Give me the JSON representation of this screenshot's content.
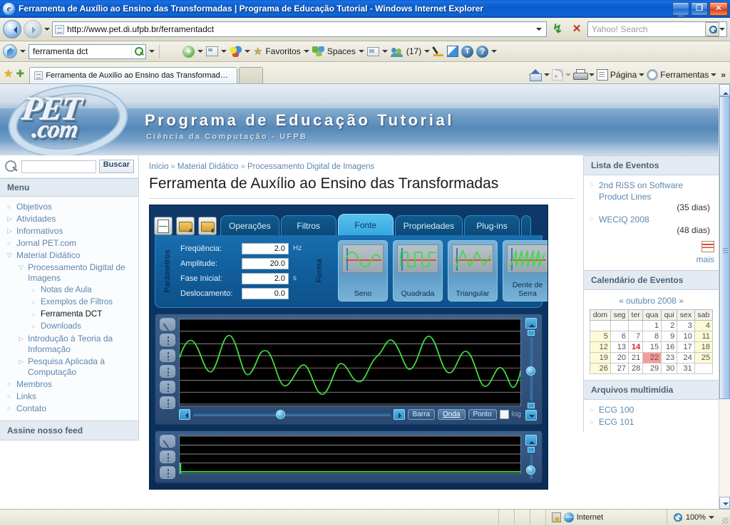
{
  "window": {
    "title": "Ferramenta de Auxílio ao Ensino das Transformadas | Programa de Educação Tutorial - Windows Internet Explorer",
    "minimize": "_",
    "maximize": "❐",
    "close": "✕"
  },
  "nav": {
    "url": "http://www.pet.di.ufpb.br/ferramentadct",
    "search_placeholder": "Yahoo! Search",
    "search_value": ""
  },
  "toolbar2": {
    "search_value": "ferramenta dct",
    "favoritos": "Favoritos",
    "spaces": "Spaces",
    "people_count": "(17)"
  },
  "tabbar": {
    "tab_title": "Ferramenta de Auxilio ao Ensino das Transformadas | ...",
    "pagina": "Página",
    "ferramentas": "Ferramentas",
    "overflow": "»"
  },
  "site": {
    "logo_pet": "PET",
    "logo_com": ".com",
    "heading": "Programa de Educação Tutorial",
    "subheading": "Ciência da Computação - UFPB"
  },
  "search_box": {
    "value": "",
    "button": "Buscar"
  },
  "sidebar": {
    "heading": "Menu",
    "items": [
      {
        "label": "Objetivos",
        "level": 1,
        "marker": "circle",
        "current": false
      },
      {
        "label": "Atividades",
        "level": 1,
        "marker": "triangle",
        "current": false
      },
      {
        "label": "Informativos",
        "level": 1,
        "marker": "triangle",
        "current": false
      },
      {
        "label": "Jornal PET.com",
        "level": 1,
        "marker": "circle",
        "current": false
      },
      {
        "label": "Material Didático",
        "level": 1,
        "marker": "open",
        "current": false
      },
      {
        "label": "Processamento Digital de Imagens",
        "level": 2,
        "marker": "open",
        "current": false
      },
      {
        "label": "Notas de Aula",
        "level": 3,
        "marker": "circle",
        "current": false
      },
      {
        "label": "Exemplos de Filtros",
        "level": 3,
        "marker": "circle",
        "current": false
      },
      {
        "label": "Ferramenta DCT",
        "level": 3,
        "marker": "circle",
        "current": true
      },
      {
        "label": "Downloads",
        "level": 3,
        "marker": "circle",
        "current": false
      },
      {
        "label": "Introdução à Teoria da Informação",
        "level": 2,
        "marker": "triangle",
        "current": false
      },
      {
        "label": "Pesquisa Aplicada à Computação",
        "level": 2,
        "marker": "triangle",
        "current": false
      },
      {
        "label": "Membros",
        "level": 1,
        "marker": "circle",
        "current": false
      },
      {
        "label": "Links",
        "level": 1,
        "marker": "circle",
        "current": false
      },
      {
        "label": "Contato",
        "level": 1,
        "marker": "circle",
        "current": false
      }
    ],
    "feed_heading": "Assine nosso feed"
  },
  "breadcrumb": {
    "items": [
      "Início",
      "Material Didático",
      "Processamento Digital de Imagens"
    ],
    "separator": "»"
  },
  "page": {
    "title": "Ferramenta de Auxílio ao Ensino das Transformadas"
  },
  "app": {
    "toolbuttons": [
      {
        "name": "new-signal-button",
        "label": ""
      },
      {
        "name": "open-a-button",
        "label": "A"
      },
      {
        "name": "open-e-button",
        "label": "E"
      }
    ],
    "tabs": [
      {
        "label": "Operações",
        "active": false
      },
      {
        "label": "Filtros",
        "active": false
      },
      {
        "label": "Fonte",
        "active": true
      },
      {
        "label": "Propriedades",
        "active": false
      },
      {
        "label": "Plug-ins",
        "active": false
      }
    ],
    "params_label": "Parâmetros",
    "params": [
      {
        "label": "Freqüência:",
        "value": "2.0",
        "unit": "Hz"
      },
      {
        "label": "Amplitude:",
        "value": "20.0",
        "unit": ""
      },
      {
        "label": "Fase Inicial:",
        "value": "2.0",
        "unit": "s"
      },
      {
        "label": "Deslocamento:",
        "value": "0.0",
        "unit": ""
      }
    ],
    "forma_label": "Forma",
    "shapes": [
      {
        "label": "Seno",
        "icon": "sine-wave-icon"
      },
      {
        "label": "Quadrada",
        "icon": "square-wave-icon"
      },
      {
        "label": "Triangular",
        "icon": "triangle-wave-icon"
      },
      {
        "label": "Dente de Serra",
        "icon": "sawtooth-wave-icon"
      }
    ],
    "view_modes": [
      {
        "label": "Barra",
        "selected": false
      },
      {
        "label": "Onda",
        "selected": true
      },
      {
        "label": "Ponto",
        "selected": false
      }
    ],
    "log_label": "log",
    "log_checked": false
  },
  "events": {
    "heading": "Lista de Eventos",
    "items": [
      {
        "title": "2nd RiSS on Software Product Lines",
        "days": "(35 dias)"
      },
      {
        "title": "WECIQ 2008",
        "days": "(48 dias)"
      }
    ],
    "more": "mais"
  },
  "calendar": {
    "heading": "Calendário de Eventos",
    "prev": "«",
    "next": "»",
    "month": "outubro 2008",
    "weekdays": [
      "dom",
      "seg",
      "ter",
      "qua",
      "qui",
      "sex",
      "sab"
    ],
    "weeks": [
      [
        "",
        "",
        "",
        "1",
        "2",
        "3",
        "4"
      ],
      [
        "5",
        "6",
        "7",
        "8",
        "9",
        "10",
        "11"
      ],
      [
        "12",
        "13",
        "14",
        "15",
        "16",
        "17",
        "18"
      ],
      [
        "19",
        "20",
        "21",
        "22",
        "23",
        "24",
        "25"
      ],
      [
        "26",
        "27",
        "28",
        "29",
        "30",
        "31",
        ""
      ]
    ],
    "today": "14",
    "event_day": "22"
  },
  "multimedia": {
    "heading": "Arquivos multimídia",
    "items": [
      "ECG 100",
      "ECG 101"
    ]
  },
  "status": {
    "text": "",
    "zone": "Internet",
    "zoom": "100%"
  },
  "colors": {
    "title_blue": "#0a5bcb",
    "accent_link": "#5d87ad",
    "app_bg": "#0b3361",
    "tab_active": "#56c2ef",
    "wave_green": "#44dd44",
    "today_red": "#d81b1b",
    "event_pink": "#f79a96"
  }
}
